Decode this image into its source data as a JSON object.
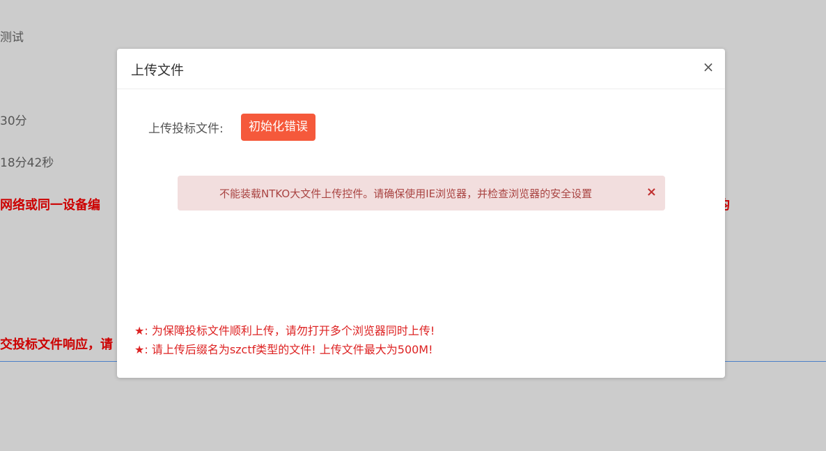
{
  "background": {
    "line1": "测试",
    "line2": "30分",
    "line3": "18分42秒",
    "warning_left": "网络或同一设备编",
    "warning_right": "均",
    "bottom_left": "交投标文件响应，请"
  },
  "modal": {
    "title": "上传文件",
    "close_symbol": "×",
    "upload_label": "上传投标文件:",
    "init_button_label": "初始化错误",
    "alert": {
      "message": "不能装载NTKO大文件上传控件。请确保使用IE浏览器，并检查浏览器的安全设置",
      "close_symbol": "×"
    },
    "notes": [
      "★: 为保障投标文件顺利上传，请勿打开多个浏览器同时上传!",
      "★: 请上传后缀名为szctf类型的文件! 上传文件最大为500M!"
    ]
  },
  "colors": {
    "overlay": "#cccccc",
    "button": "#f5593b",
    "alert_bg": "#f2dede",
    "alert_text": "#a94442",
    "note_text": "#dd2222"
  }
}
